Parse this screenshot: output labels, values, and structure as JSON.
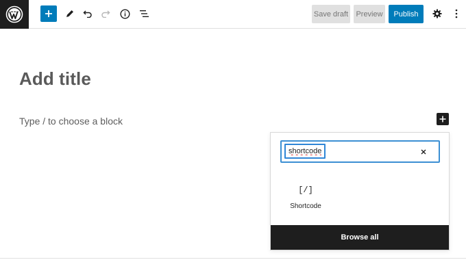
{
  "toolbar": {
    "save_draft_label": "Save draft",
    "preview_label": "Preview",
    "publish_label": "Publish",
    "accent_color": "#007cba"
  },
  "editor": {
    "title_placeholder": "Add title",
    "block_prompt": "Type / to choose a block"
  },
  "inserter": {
    "search_value": "shortcode",
    "results": [
      {
        "icon_text": "[/]",
        "label": "Shortcode"
      }
    ],
    "browse_all_label": "Browse all"
  }
}
